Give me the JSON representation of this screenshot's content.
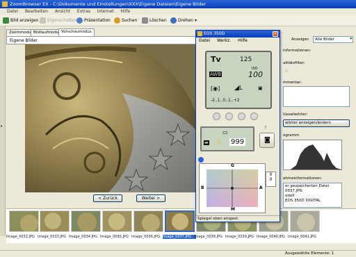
{
  "app": {
    "title": "ZoomBrowser EX - C:\\Dokumente und Einstellungen\\XXX\\Eigene Dateien\\Eigene Bilder"
  },
  "menu": [
    "Datei",
    "Bearbeiten",
    "Ansicht",
    "Extras",
    "Internet",
    "Hilfe"
  ],
  "toolbar": {
    "show_image": "Bild anzeigen",
    "properties": "Eigenschaften",
    "presentation": "Präsentation",
    "search": "Suchen",
    "delete": "Löschen",
    "rotate": "Drehen"
  },
  "tabs": [
    "Zoommodus",
    "Bildlaufmodus",
    "Vorschaumodus"
  ],
  "folder": "Eigene Bilder",
  "nav": {
    "back": "< Zurück",
    "next": "Weiter >"
  },
  "thumbnails": [
    "Image_0032.JPG",
    "Image_0033.JPG",
    "Image_0034.JPG",
    "Image_0035.JPG",
    "Image_0036.JPG",
    "Image_0037.JPG",
    "Image_0038.JPG",
    "Image_0039.JPG",
    "Image_0040.JPG",
    "Image_0041.JPG"
  ],
  "selected_thumbnail": "Image_0037.JPG",
  "statusbar": {
    "selected": "Ausgewählte Elemente: 1"
  },
  "right": {
    "show_label": "Anzeigen",
    "show_value": "Alle Bilder",
    "info_header": "informationen:",
    "quality_filter": "alitätsfilter:",
    "comment": "mmentar:",
    "keywords": "lüsselwörter:",
    "keywords_button": "wörter anzeigen/ändern",
    "histogram": "ogramm",
    "capture_info": "ahmeinformationen:",
    "info_lines": [
      "er gespeicherten Datei",
      "0037.JPG",
      "odell",
      "EOS 350D DIGITAL"
    ]
  },
  "eos": {
    "title": "EOS 350D",
    "menu": [
      "Datei",
      "Werkz.",
      "Hilfe"
    ],
    "mode": "Tv",
    "shutter": "125",
    "iso_label": "ISO",
    "iso": "100",
    "wb": "AWB",
    "quality": "L",
    "exposure_scale": "-2..1..0..1..+2",
    "shots": "999",
    "axis": {
      "g": "G",
      "m": "M",
      "b": "B",
      "a": "A"
    },
    "shift_values": [
      "0",
      "0"
    ],
    "status": "Spiegel oben eingest."
  },
  "colors": {
    "accent": "#0a3fb4",
    "selection": "#316ac5",
    "lcd": "#c8d3c0"
  }
}
